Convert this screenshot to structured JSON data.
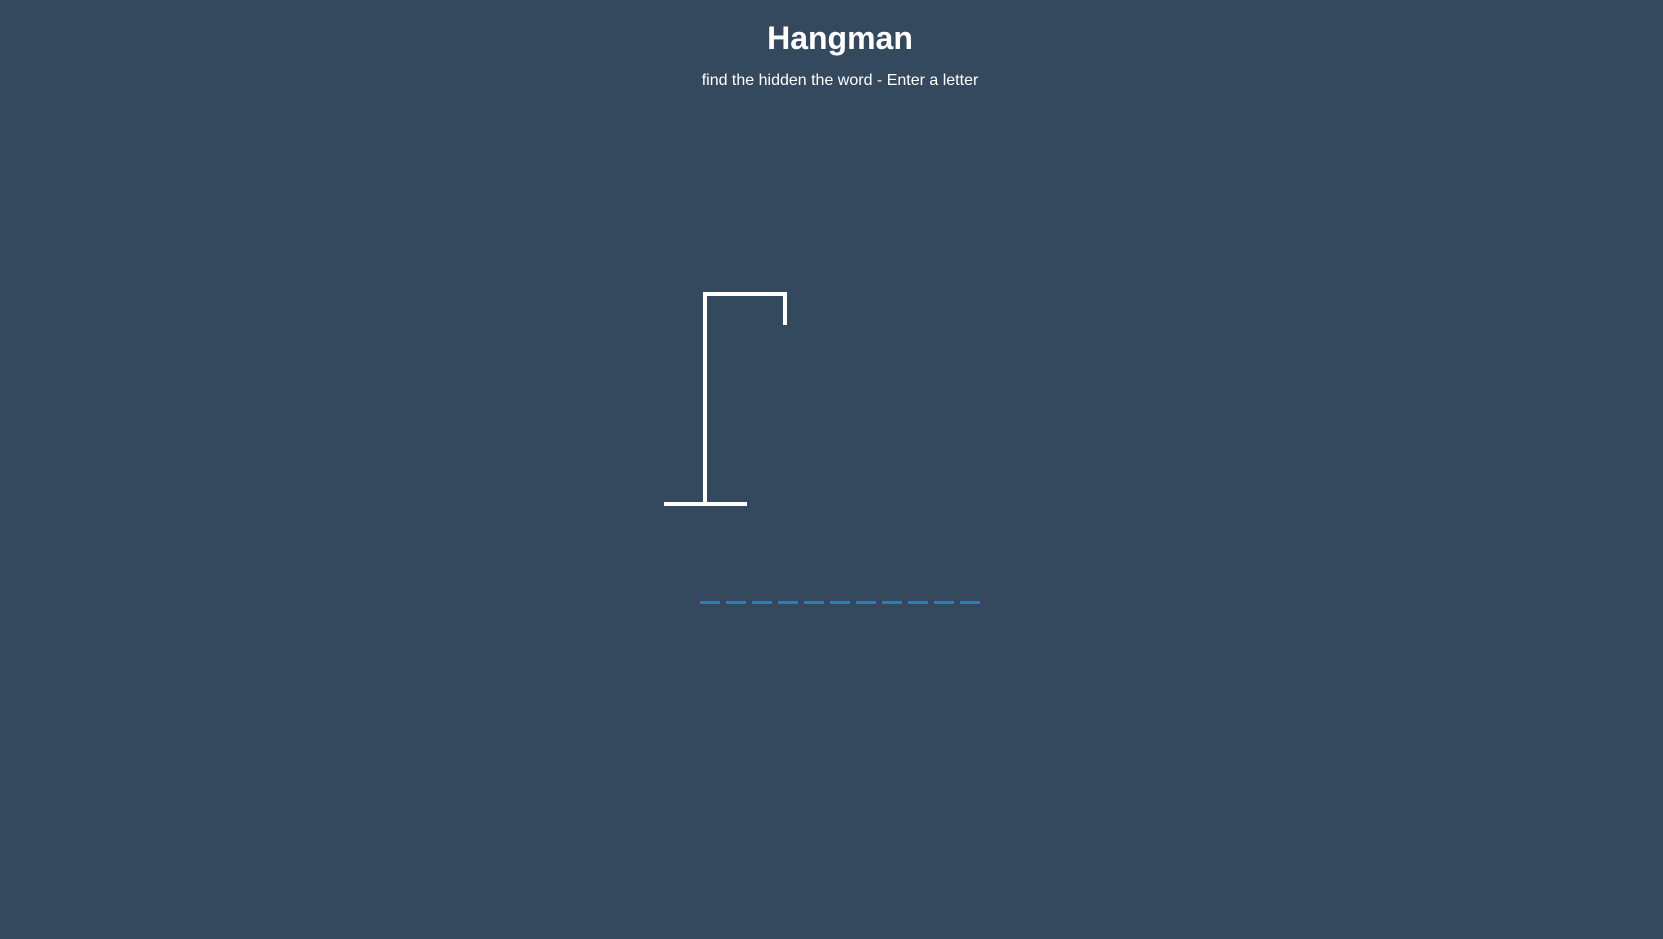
{
  "header": {
    "title": "Hangman",
    "subtitle": "find the hidden the word - Enter a letter"
  },
  "game": {
    "word_slots": [
      "",
      "",
      "",
      "",
      "",
      "",
      "",
      "",
      "",
      "",
      ""
    ],
    "wrong_guesses": 0
  },
  "colors": {
    "background": "#34495e",
    "figure": "#ffffff",
    "letter_slot_underline": "#2980b9"
  }
}
